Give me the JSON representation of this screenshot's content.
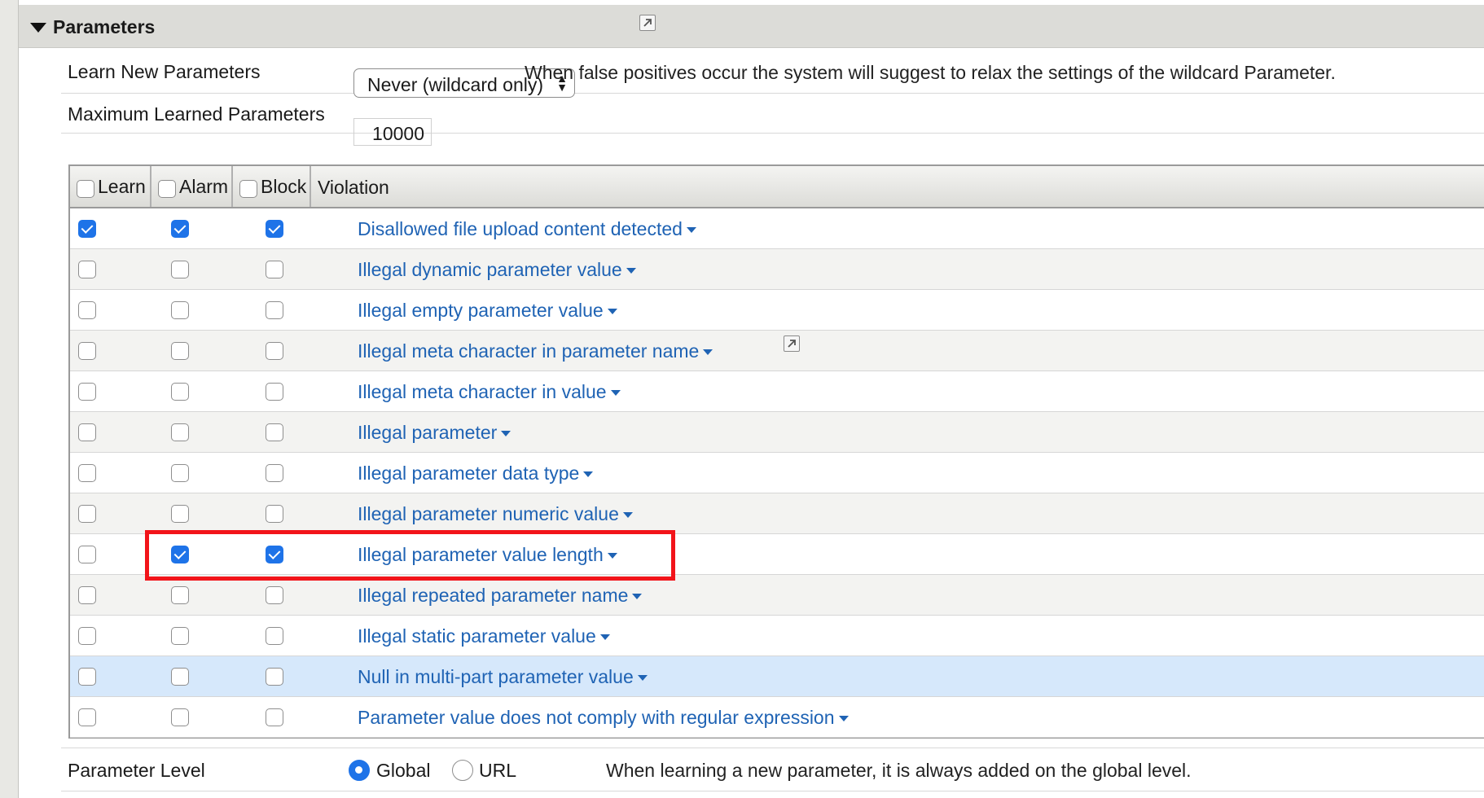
{
  "section": {
    "title": "Parameters"
  },
  "settings": {
    "learn_new": {
      "label": "Learn New Parameters",
      "selected": "Never (wildcard only)",
      "help": "When false positives occur the system will suggest to relax the settings of the wildcard Parameter."
    },
    "max_learned": {
      "label": "Maximum Learned Parameters",
      "value": "10000"
    },
    "level": {
      "label": "Parameter Level",
      "options": [
        {
          "label": "Global",
          "selected": true
        },
        {
          "label": "URL",
          "selected": false
        }
      ],
      "help": "When learning a new parameter, it is always added on the global level."
    }
  },
  "table": {
    "headers": {
      "learn": "Learn",
      "alarm": "Alarm",
      "block": "Block",
      "violation": "Violation"
    },
    "rows": [
      {
        "violation": "Disallowed file upload content detected",
        "learn": true,
        "alarm": true,
        "block": true
      },
      {
        "violation": "Illegal dynamic parameter value",
        "learn": false,
        "alarm": false,
        "block": false
      },
      {
        "violation": "Illegal empty parameter value",
        "learn": false,
        "alarm": false,
        "block": false
      },
      {
        "violation": "Illegal meta character in parameter name",
        "learn": false,
        "alarm": false,
        "block": false
      },
      {
        "violation": "Illegal meta character in value",
        "learn": false,
        "alarm": false,
        "block": false
      },
      {
        "violation": "Illegal parameter",
        "learn": false,
        "alarm": false,
        "block": false
      },
      {
        "violation": "Illegal parameter data type",
        "learn": false,
        "alarm": false,
        "block": false
      },
      {
        "violation": "Illegal parameter numeric value",
        "learn": false,
        "alarm": false,
        "block": false
      },
      {
        "violation": "Illegal parameter value length",
        "learn": false,
        "alarm": true,
        "block": true
      },
      {
        "violation": "Illegal repeated parameter name",
        "learn": false,
        "alarm": false,
        "block": false
      },
      {
        "violation": "Illegal static parameter value",
        "learn": false,
        "alarm": false,
        "block": false
      },
      {
        "violation": "Null in multi-part parameter value",
        "learn": false,
        "alarm": false,
        "block": false
      },
      {
        "violation": "Parameter value does not comply with regular expression",
        "learn": false,
        "alarm": false,
        "block": false
      }
    ]
  },
  "colors": {
    "link": "#1f63b4",
    "checkbox_checked": "#1e73e8",
    "highlight_box": "#f2141a",
    "selected_row": "#d6e8fb"
  },
  "icons": {
    "section_toggle": "triangle-down-icon",
    "popout": "popout-icon",
    "dropdown": "caret-down-icon"
  }
}
